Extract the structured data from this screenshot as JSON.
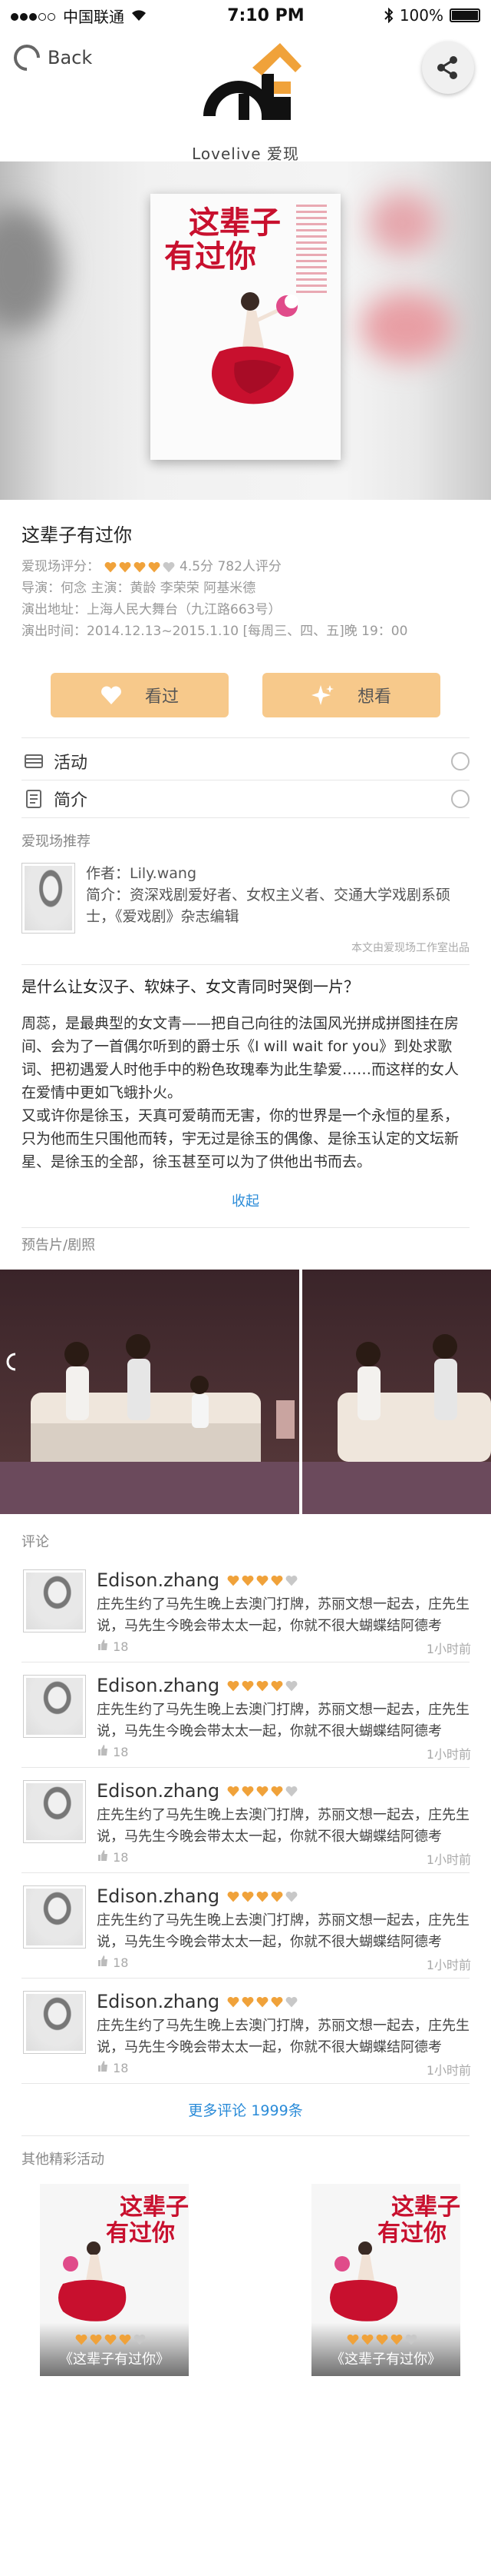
{
  "status_bar": {
    "carrier": "中国联通",
    "time": "7:10 PM",
    "battery": "100%"
  },
  "header": {
    "back_label": "Back",
    "brand": "Lovelive 爱现场"
  },
  "poster_title": [
    "这辈子",
    "有过你"
  ],
  "show": {
    "title": "这辈子有过你",
    "rating_label": "爱现场评分：",
    "rating_value": 4,
    "rating_max": 5,
    "rating_text": "4.5分 782人评分",
    "director_cast": "导演：何念   主演：黄龄  李荣荣  阿基米德",
    "venue": "演出地址：上海人民大舞台（九江路663号）",
    "time": "演出时间：2014.12.13~2015.1.10 [每周三、四、五]晚 19：00"
  },
  "actions": {
    "seen_label": "看过",
    "want_label": "想看"
  },
  "menu": {
    "activity_label": "活动",
    "intro_label": "简介"
  },
  "recommend": {
    "section_label": "爱现场推荐",
    "author": "作者：Lily.wang",
    "bio": "简介：资深戏剧爱好者、女权主义者、交通大学戏剧系硕士，《爱戏剧》杂志编辑",
    "note": "本文由爱现场工作室出品"
  },
  "article": {
    "question": "是什么让女汉子、软妹子、女文青同时哭倒一片？",
    "p1": "周蕊，是最典型的女文青——把自己向往的法国风光拼成拼图挂在房间、会为了一首偶尔听到的爵士乐《I will wait for you》到处求歌词、把初遇爱人时他手中的粉色玫瑰奉为此生挚爱……而这样的女人在爱情中更如飞蛾扑火。",
    "p2": "又或许你是徐玉，天真可爱萌而无害，你的世界是一个永恒的星系，只为他而生只围他而转，宇无过是徐玉的偶像、是徐玉认定的文坛新星、是徐玉的全部，徐玉甚至可以为了供他出书而去。",
    "collapse_label": "收起"
  },
  "trailer": {
    "section_label": "预告片/剧照"
  },
  "comments": {
    "section_label": "评论",
    "items": [
      {
        "name": "Edison.zhang",
        "rating": 4,
        "text": "庄先生约了马先生晚上去澳门打牌，苏丽文想一起去，庄先生说，马先生今晚会带太太一起，你就不很大蝴蝶结阿德考",
        "likes": "18",
        "time": "1小时前"
      },
      {
        "name": "Edison.zhang",
        "rating": 4,
        "text": "庄先生约了马先生晚上去澳门打牌，苏丽文想一起去，庄先生说，马先生今晚会带太太一起，你就不很大蝴蝶结阿德考",
        "likes": "18",
        "time": "1小时前"
      },
      {
        "name": "Edison.zhang",
        "rating": 4,
        "text": "庄先生约了马先生晚上去澳门打牌，苏丽文想一起去，庄先生说，马先生今晚会带太太一起，你就不很大蝴蝶结阿德考",
        "likes": "18",
        "time": "1小时前"
      },
      {
        "name": "Edison.zhang",
        "rating": 4,
        "text": "庄先生约了马先生晚上去澳门打牌，苏丽文想一起去，庄先生说，马先生今晚会带太太一起，你就不很大蝴蝶结阿德考",
        "likes": "18",
        "time": "1小时前"
      },
      {
        "name": "Edison.zhang",
        "rating": 4,
        "text": "庄先生约了马先生晚上去澳门打牌，苏丽文想一起去，庄先生说，马先生今晚会带太太一起，你就不很大蝴蝶结阿德考",
        "likes": "18",
        "time": "1小时前"
      }
    ],
    "more_label": "更多评论 1999条"
  },
  "other": {
    "section_label": "其他精彩活动",
    "cards": [
      {
        "title": "《这辈子有过你》",
        "rating": 4
      },
      {
        "title": "《这辈子有过你》",
        "rating": 4
      }
    ]
  },
  "colors": {
    "accent": "#f0a23a",
    "button": "#f7c98b",
    "link": "#2a8bd8",
    "poster_red": "#c8102e"
  }
}
